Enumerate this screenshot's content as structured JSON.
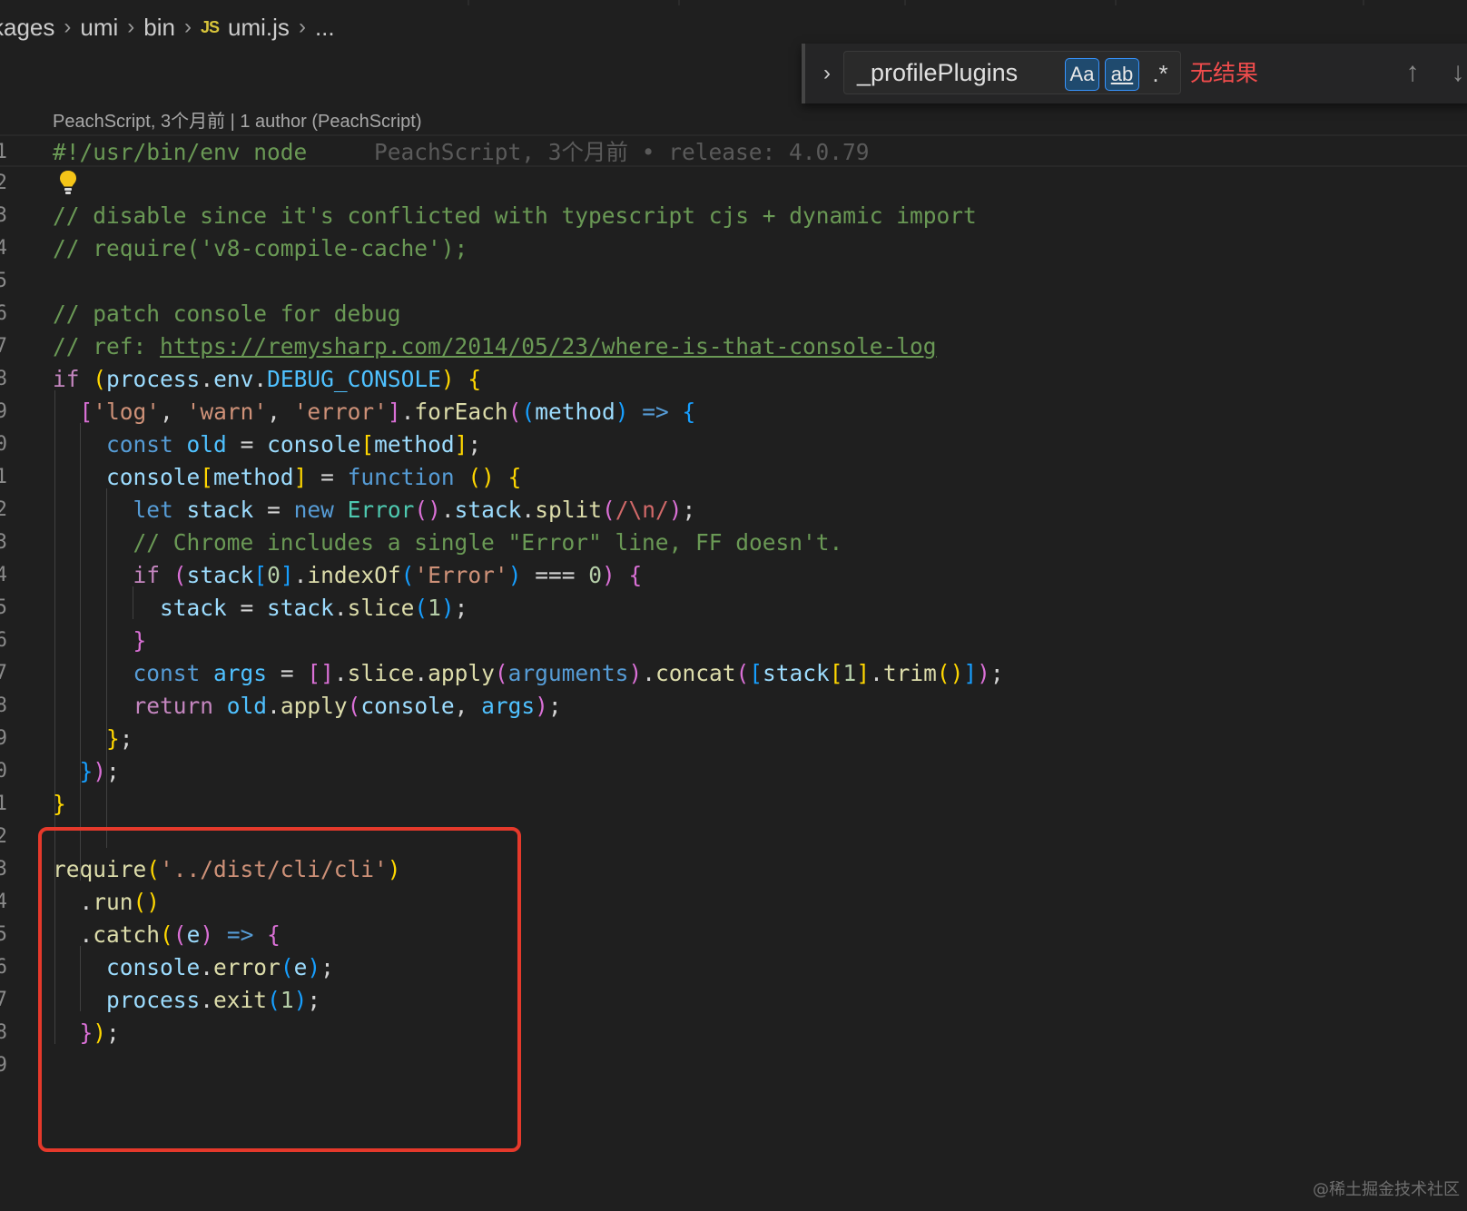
{
  "breadcrumb": {
    "items": [
      "kages",
      "umi",
      "bin",
      "umi.js",
      "..."
    ],
    "file_badge": "JS"
  },
  "find_widget": {
    "query": "_profilePlugins",
    "match_case_label": "Aa",
    "whole_word_label": "ab",
    "regex_label": ".*",
    "status": "无结果",
    "prev_icon": "arrow-up-icon",
    "next_icon": "arrow-down-icon"
  },
  "editor": {
    "blame_header": "PeachScript, 3个月前 | 1 author (PeachScript)",
    "inline_blame": "PeachScript, 3个月前 • release: 4.0.79",
    "line_numbers": [
      "1",
      "2",
      "3",
      "4",
      "5",
      "6",
      "7",
      "8",
      "9",
      "0",
      "1",
      "2",
      "3",
      "4",
      "5",
      "6",
      "7",
      "8",
      "9",
      "0",
      "1",
      "2",
      "3",
      "4",
      "5",
      "6",
      "7",
      "8",
      "9"
    ],
    "comments": {
      "shebang": "#!/usr/bin/env node",
      "c3": "// disable since it's conflicted with typescript cjs + dynamic import",
      "c4": "// require('v8-compile-cache');",
      "c6": "// patch console for debug",
      "c7_prefix": "// ref: ",
      "c7_url": "https://remysharp.com/2014/05/23/where-is-that-console-log",
      "c13": "// Chrome includes a single \"Error\" line, FF doesn't."
    }
  },
  "colors": {
    "background": "#1f1f1f",
    "highlight_box": "#e5392b",
    "no_results": "#f14c4c",
    "accent": "#3794ff"
  },
  "watermark": "@稀土掘金技术社区"
}
